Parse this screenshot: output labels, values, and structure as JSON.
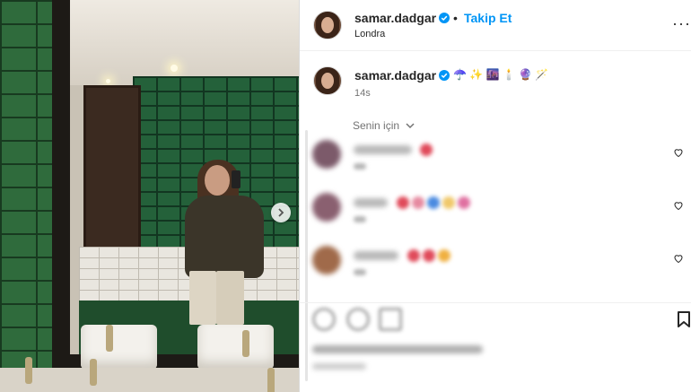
{
  "post": {
    "author": "samar.dadgar",
    "separator": "•",
    "follow_label": "Takip Et",
    "location": "Londra",
    "more_label": "···",
    "caption_emojis": "☂️ ✨ 🌆 🕯️ 🔮 🪄",
    "time_ago": "14s"
  },
  "comments": {
    "sort_label": "Senin için"
  },
  "icons": {
    "verified": "verified-badge-icon",
    "next": "chevron-right-icon",
    "chevron": "chevron-down-icon",
    "heart": "heart-outline-icon",
    "bookmark": "bookmark-icon"
  },
  "colors": {
    "accent": "#0095f6",
    "text": "#262626",
    "muted": "#737373"
  }
}
